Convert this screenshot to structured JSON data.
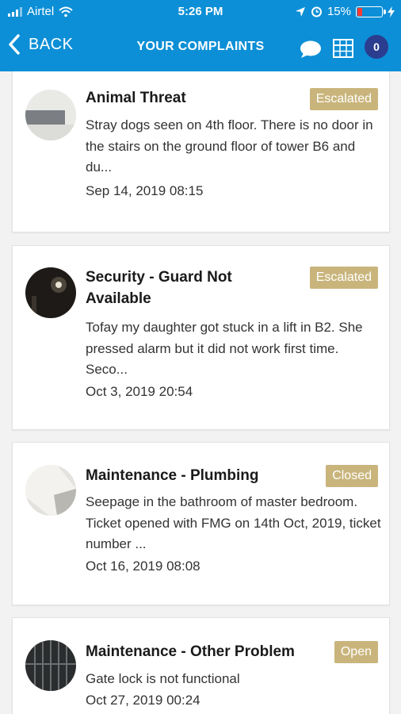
{
  "status_bar": {
    "carrier": "Airtel",
    "time": "5:26 PM",
    "battery": "15%"
  },
  "nav": {
    "back_label": "BACK",
    "title": "YOUR COMPLAINTS",
    "badge_count": "0"
  },
  "colors": {
    "nav_bg": "#0c8fd6",
    "badge": "#c9b57c",
    "count_badge": "#2b3d8f"
  },
  "complaints": [
    {
      "title": "Animal Threat",
      "status": "Escalated",
      "description": "Stray dogs seen on 4th floor. There is no door in the stairs on the ground floor of tower B6 and du...",
      "date": "Sep 14, 2019 08:15"
    },
    {
      "title": "Security - Guard Not Available",
      "status": "Escalated",
      "description": "Tofay my daughter got stuck in a lift in B2. She pressed alarm but it did not work first time. Seco...",
      "date": "Oct 3, 2019 20:54"
    },
    {
      "title": "Maintenance - Plumbing",
      "status": "Closed",
      "description": "Seepage in the bathroom of master bedroom. Ticket opened with FMG on 14th Oct, 2019, ticket number ...",
      "date": "Oct 16, 2019 08:08"
    },
    {
      "title": "Maintenance - Other Problem",
      "status": "Open",
      "description": "Gate lock is not functional",
      "date": "Oct 27, 2019 00:24"
    }
  ]
}
